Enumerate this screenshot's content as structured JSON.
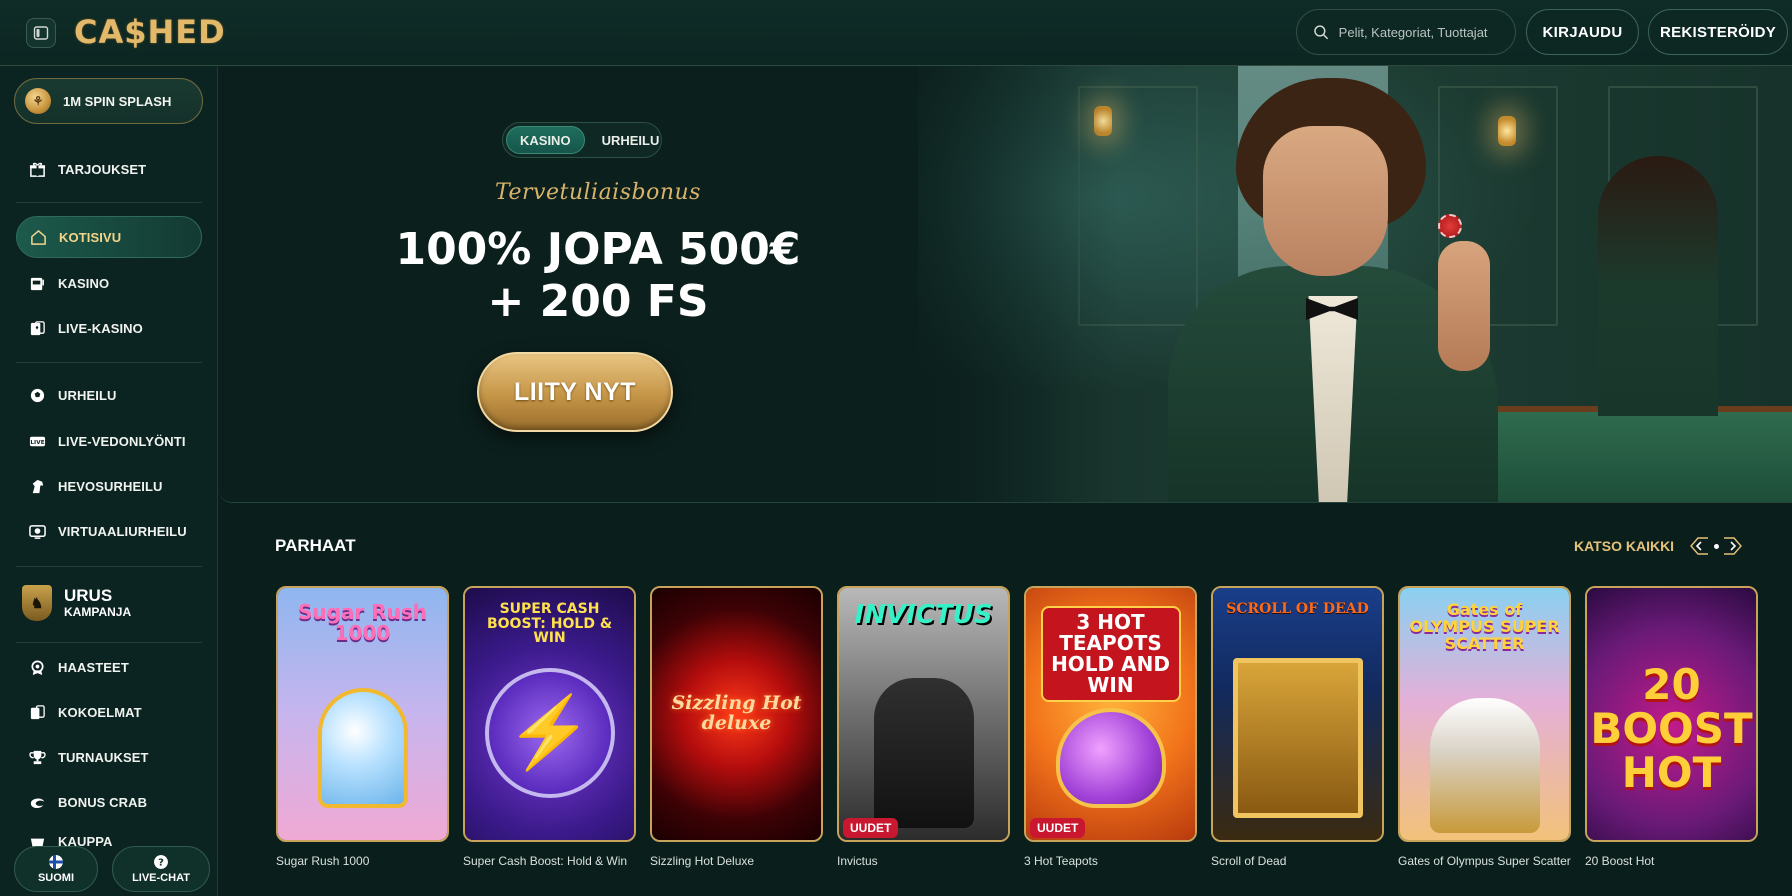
{
  "header": {
    "logo": "CA$HED",
    "search_placeholder": "Pelit, Kategoriat, Tuottajat",
    "login_label": "KIRJAUDU",
    "register_label": "REKISTERÖIDY"
  },
  "sidebar": {
    "promo": "1M SPIN SPLASH",
    "items": [
      {
        "label": "TARJOUKSET",
        "icon": "gift-icon"
      },
      {
        "label": "KOTISIVU",
        "icon": "home-icon",
        "active": true
      },
      {
        "label": "KASINO",
        "icon": "slot-machine-icon"
      },
      {
        "label": "LIVE-KASINO",
        "icon": "cards-icon"
      },
      {
        "label": "URHEILU",
        "icon": "football-icon"
      },
      {
        "label": "LIVE-VEDONLYÖNTI",
        "icon": "live-icon"
      },
      {
        "label": "HEVOSURHEILU",
        "icon": "horse-icon"
      },
      {
        "label": "VIRTUAALIURHEILU",
        "icon": "virtual-sports-icon"
      },
      {
        "label": "HAASTEET",
        "icon": "medal-icon"
      },
      {
        "label": "KOKOELMAT",
        "icon": "collection-icon"
      },
      {
        "label": "TURNAUKSET",
        "icon": "trophy-icon"
      },
      {
        "label": "BONUS CRAB",
        "icon": "crab-icon"
      },
      {
        "label": "KAUPPA",
        "icon": "shop-icon"
      }
    ],
    "campaign": {
      "title": "URUS",
      "subtitle": "KAMPANJA"
    },
    "language_label": "SUOMI",
    "chat_label": "LIVE-CHAT"
  },
  "hero": {
    "tabs": [
      "KASINO",
      "URHEILU"
    ],
    "active_tab": "KASINO",
    "subtitle": "Tervetuliaisbonus",
    "title_line1": "100% JOPA 500€",
    "title_line2": "+ 200 FS",
    "cta": "LIITY NYT"
  },
  "games_section": {
    "title": "PARHAAT",
    "see_all": "KATSO KAIKKI",
    "new_badge": "UUDET",
    "games": [
      {
        "name": "Sugar Rush 1000",
        "art_title": "Sugar Rush 1000",
        "new": false
      },
      {
        "name": "Super Cash Boost: Hold & Win",
        "art_title": "SUPER CASH BOOST: HOLD & WIN",
        "new": false
      },
      {
        "name": "Sizzling Hot Deluxe",
        "art_title": "Sizzling Hot deluxe",
        "new": false
      },
      {
        "name": "Invictus",
        "art_title": "INVICTUS",
        "new": true
      },
      {
        "name": "3 Hot Teapots",
        "art_title": "3 HOT TEAPOTS HOLD AND WIN",
        "new": true
      },
      {
        "name": "Scroll of Dead",
        "art_title": "SCROLL OF DEAD",
        "new": false
      },
      {
        "name": "Gates of Olympus Super Scatter",
        "art_title": "Gates of OLYMPUS SUPER SCATTER",
        "new": false
      },
      {
        "name": "20 Boost Hot",
        "art_title": "20 BOOST HOT",
        "new": false
      }
    ]
  },
  "colors": {
    "background": "#0a1f1c",
    "accent_gold": "#e2b96a",
    "active_nav": "#1c5a4c",
    "new_badge": "#c8172e"
  }
}
